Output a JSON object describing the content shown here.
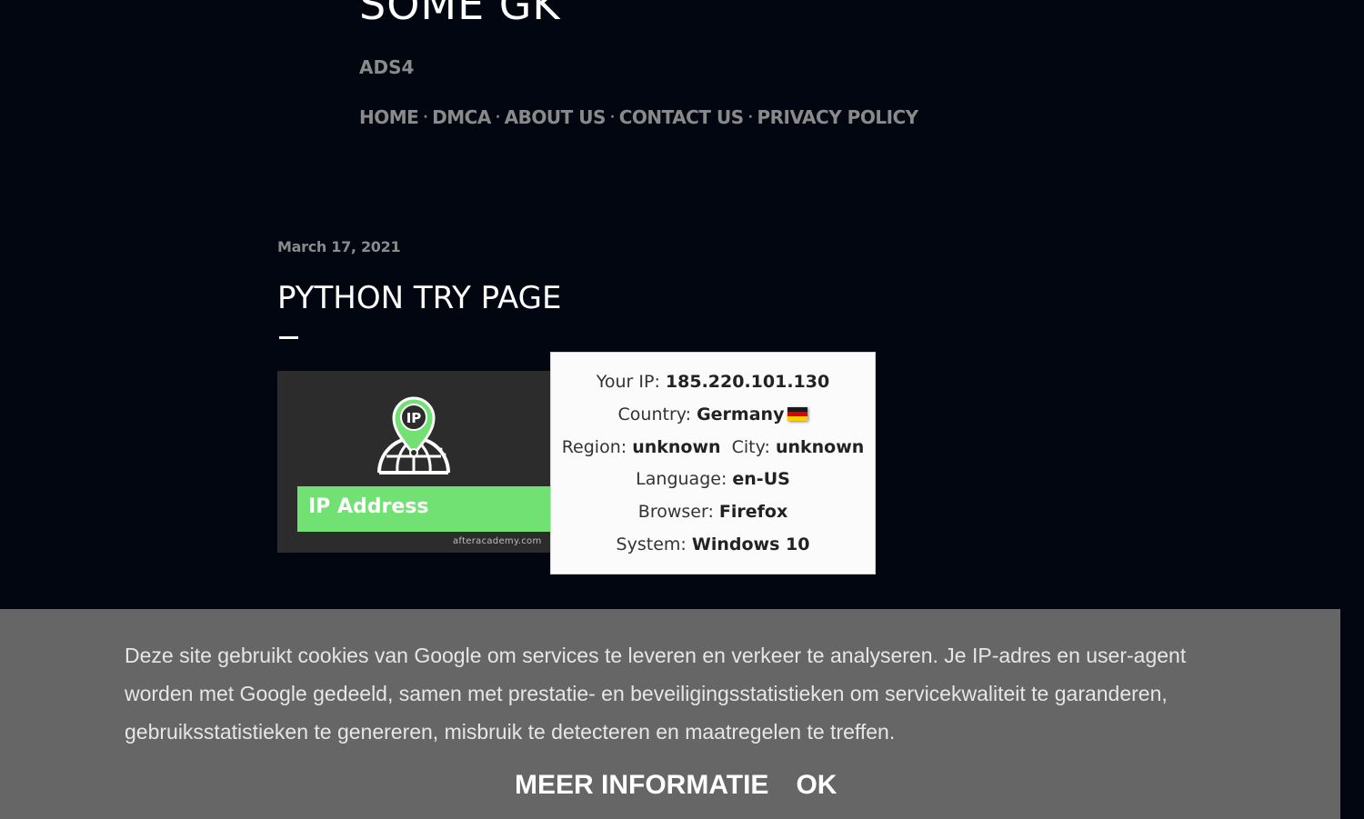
{
  "site": {
    "title": "SOME GK",
    "description": "ADS4"
  },
  "nav": {
    "items": [
      "HOME",
      "DMCA",
      "ABOUT US",
      "CONTACT US",
      "PRIVACY POLICY"
    ],
    "separator": "·"
  },
  "post": {
    "date": "March 17, 2021",
    "title": "PYTHON TRY PAGE"
  },
  "ip_image": {
    "label": "IP Address",
    "credit": "afteracademy.com",
    "pin_text": "IP",
    "accent_color": "#72e173"
  },
  "ip_card": {
    "ip_label": "Your IP:",
    "ip_value": "185.220.101.130",
    "country_label": "Country:",
    "country_value": "Germany",
    "region_label": "Region:",
    "region_value": "unknown",
    "city_label": "City:",
    "city_value": "unknown",
    "language_label": "Language:",
    "language_value": "en-US",
    "browser_label": "Browser:",
    "browser_value": "Firefox",
    "system_label": "System:",
    "system_value": "Windows 10",
    "flag_colors": [
      "#1a1a1a",
      "#dd0000",
      "#ffce00"
    ]
  },
  "cookie": {
    "text": "Deze site gebruikt cookies van Google om services te leveren en verkeer te analyseren. Je IP-adres en user-agent worden met Google gedeeld, samen met prestatie- en beveiligingsstatistieken om servicekwaliteit te garanderen, gebruiksstatistieken te genereren, misbruik te detecteren en maatregelen te treffen.",
    "more_info": "MEER INFORMATIE",
    "ok": "OK"
  }
}
